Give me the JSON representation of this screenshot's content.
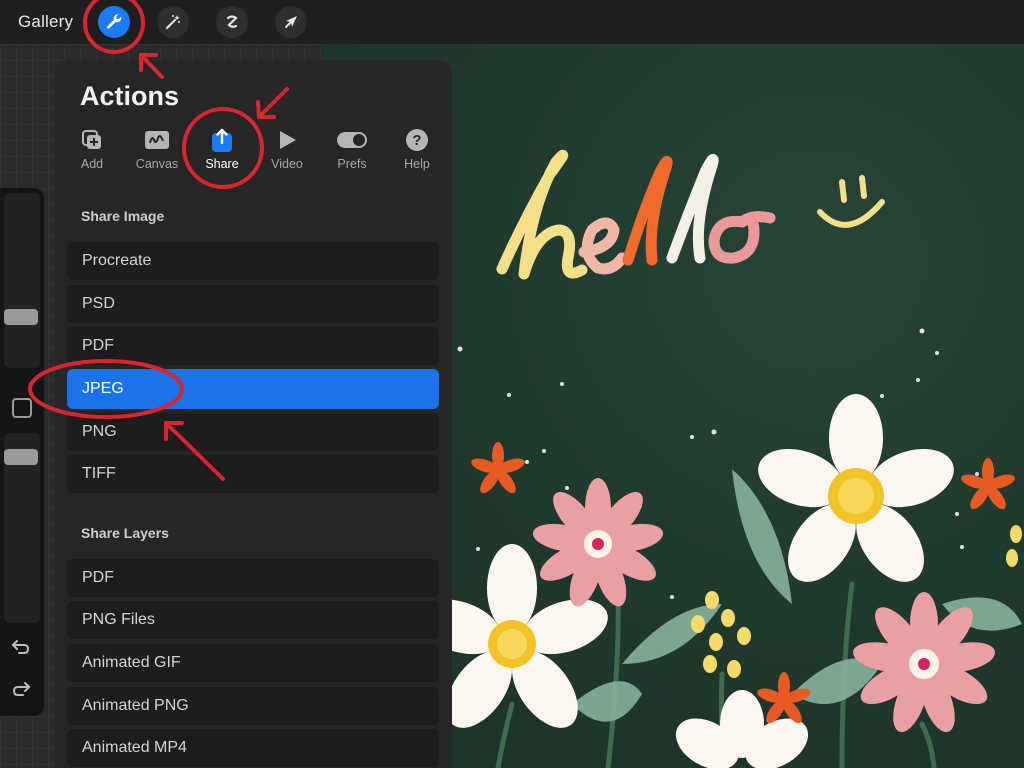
{
  "topbar": {
    "gallery_label": "Gallery",
    "tools": [
      "wrench-icon",
      "magic-wand-icon",
      "selection-icon",
      "transform-arrow-icon"
    ],
    "active_tool": "wrench-icon"
  },
  "canvas": {
    "lettering": "hello"
  },
  "actions": {
    "title": "Actions",
    "tabs": [
      {
        "label": "Add",
        "icon": "add-icon"
      },
      {
        "label": "Canvas",
        "icon": "canvas-icon"
      },
      {
        "label": "Share",
        "icon": "share-icon"
      },
      {
        "label": "Video",
        "icon": "video-icon"
      },
      {
        "label": "Prefs",
        "icon": "prefs-toggle-icon"
      },
      {
        "label": "Help",
        "icon": "help-icon"
      }
    ],
    "active_tab": "Share",
    "share_image": {
      "heading": "Share Image",
      "items": [
        "Procreate",
        "PSD",
        "PDF",
        "JPEG",
        "PNG",
        "TIFF"
      ],
      "selected": "JPEG"
    },
    "share_layers": {
      "heading": "Share Layers",
      "items": [
        "PDF",
        "PNG Files",
        "Animated GIF",
        "Animated PNG",
        "Animated MP4"
      ]
    }
  },
  "colors": {
    "accent_blue": "#1a73e8",
    "annotation_red": "#d7262f",
    "canvas_green": "#213a2e"
  }
}
